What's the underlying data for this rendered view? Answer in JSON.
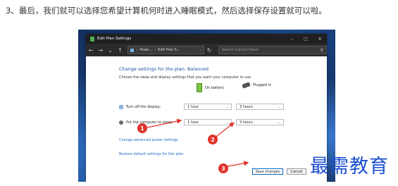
{
  "caption": "3、最后，我们就可以选择您希望计算机何时进入睡眠模式，然后选择保存设置就可以啦。",
  "window": {
    "title": "Edit Plan Settings",
    "controls": {
      "minimize": "–",
      "maximize": "▢",
      "close": "✕"
    }
  },
  "toolbar": {
    "back": "←",
    "forward": "→",
    "dropdown": "⌄",
    "up": "↑",
    "address": [
      "Powe...",
      "Edit Plan S..."
    ],
    "address_sep": "›",
    "address_drop": "⌄",
    "refresh": "↻",
    "search_placeholder": "Search Control Panel",
    "search_icon": "⚲"
  },
  "content": {
    "heading": "Change settings for the plan: Balanced",
    "subheading": "Choose the sleep and display settings that you want your computer to use.",
    "col_battery": "On battery",
    "col_plugged": "Plugged in",
    "rows": [
      {
        "label": "Turn off the display:",
        "battery": "1 hour",
        "plugged": "3 hours",
        "icon": "display-icon"
      },
      {
        "label": "Put the computer to sleep:",
        "battery": "1 hour",
        "plugged": "3 hours",
        "icon": "moon-icon"
      }
    ],
    "chevron": "⌄",
    "link_advanced": "Change advanced power settings",
    "link_restore": "Restore default settings for this plan",
    "save_button": "Save changes",
    "cancel_button": "Cancel"
  },
  "annotations": [
    "1",
    "2",
    "3"
  ],
  "watermark": "最需教育",
  "colors": {
    "accent": "#1a4fa0",
    "annotation": "#e0332b",
    "watermark": "#1b4fd0"
  }
}
